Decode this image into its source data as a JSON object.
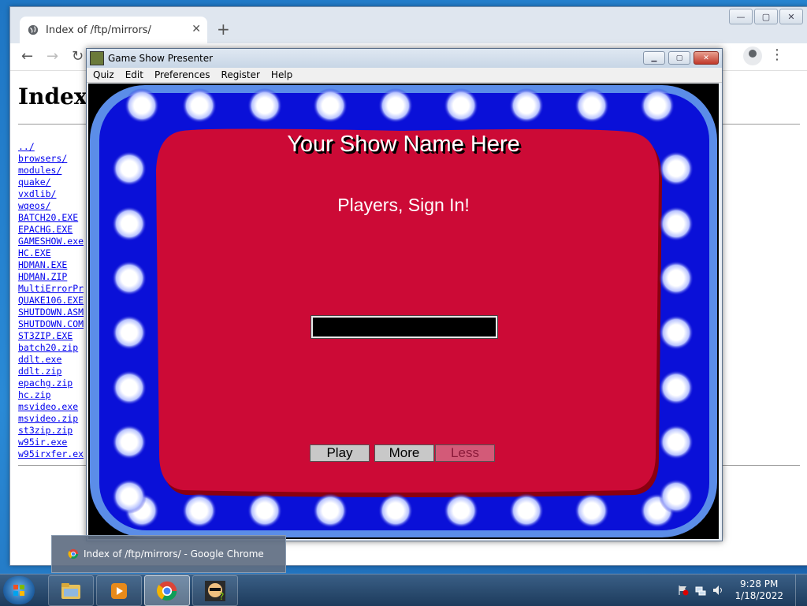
{
  "browser": {
    "tab_title": "Index of /ftp/mirrors/",
    "page_heading": "Index",
    "files": [
      "../",
      "browsers/",
      "modules/",
      "quake/",
      "vxdlib/",
      "wqeos/",
      "BATCH20.EXE",
      "EPACHG.EXE",
      "GAMESHOW.exe",
      "HC.EXE",
      "HDMAN.EXE",
      "HDMAN.ZIP",
      "MultiErrorPr",
      "QUAKE106.EXE",
      "SHUTDOWN.ASM",
      "SHUTDOWN.COM",
      "ST3ZIP.EXE",
      "batch20.zip",
      "ddlt.exe",
      "ddlt.zip",
      "epachg.zip",
      "hc.zip",
      "msvideo.exe",
      "msvideo.zip",
      "st3zip.zip",
      "w95ir.exe",
      "w95irxfer.ex"
    ]
  },
  "gameshow": {
    "window_title": "Game Show Presenter",
    "menu": [
      "Quiz",
      "Edit",
      "Preferences",
      "Register",
      "Help"
    ],
    "show_name": "Your Show Name Here",
    "prompt": "Players, Sign In!",
    "player_name_value": "",
    "buttons": {
      "play": "Play",
      "more": "More",
      "less": "Less"
    },
    "colors": {
      "board_red": "#cc0a36",
      "frame_blue": "#0a10d8",
      "frame_edge": "#5b8de8",
      "button_gray": "#c8c8c8",
      "less_pink": "#d35a78"
    }
  },
  "tooltip": {
    "text": "Index of /ftp/mirrors/ - Google Chrome"
  },
  "taskbar": {
    "apps": [
      "file-explorer-icon",
      "media-player-icon",
      "chrome-icon",
      "gameshow-app-icon"
    ],
    "time": "9:28 PM",
    "date": "1/18/2022"
  }
}
